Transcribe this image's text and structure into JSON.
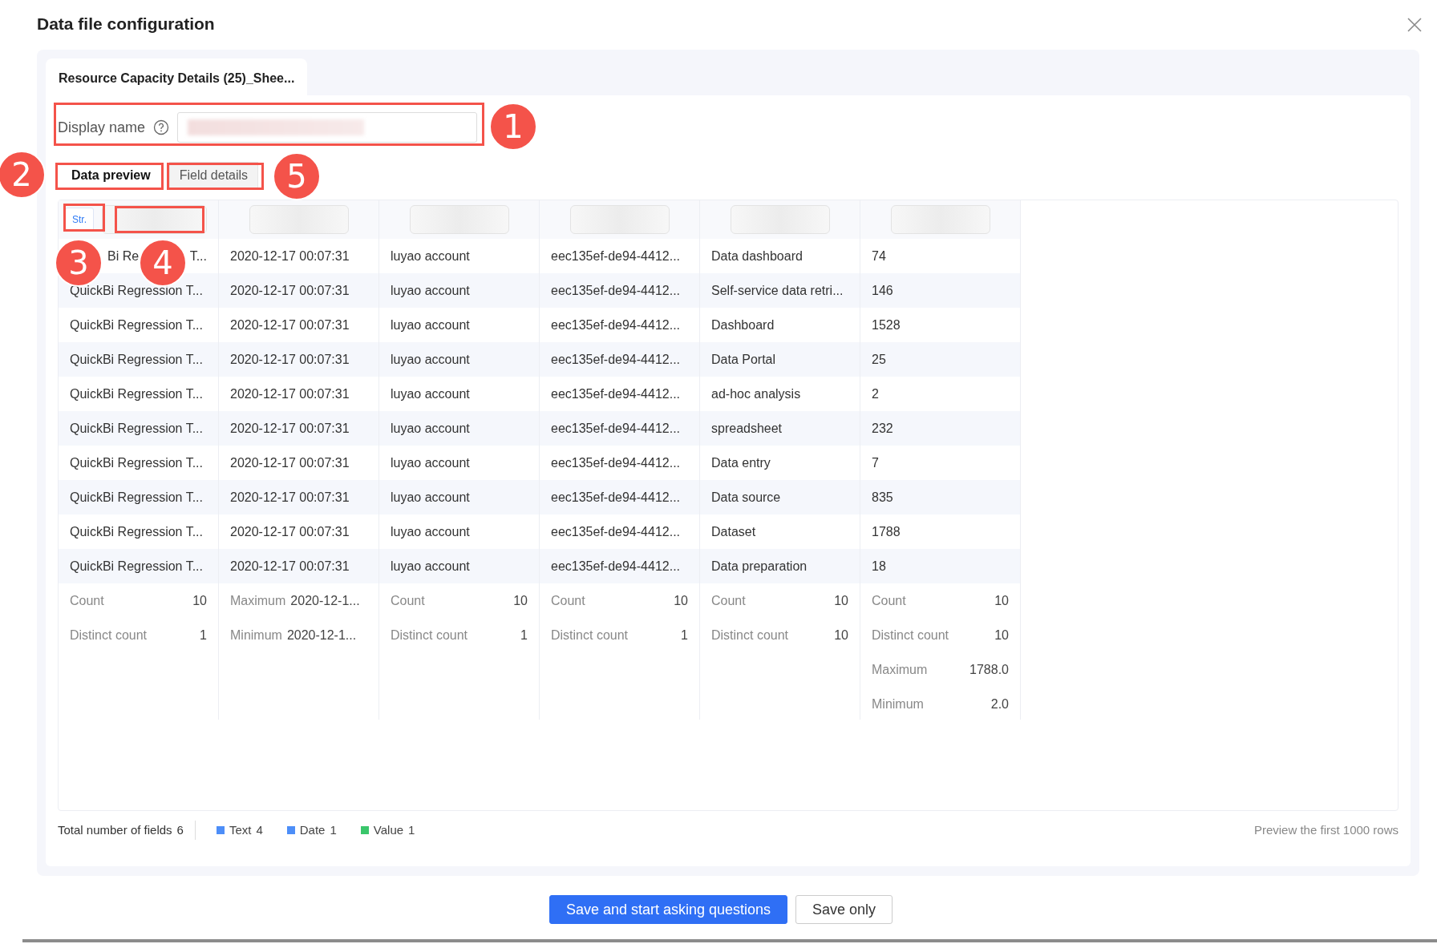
{
  "title": "Data file configuration",
  "sheet_tab": {
    "label": "Resource Capacity Details (25)_Shee...",
    "selected": true
  },
  "display_name": {
    "label": "Display name"
  },
  "view_tabs": [
    {
      "label": "Data preview",
      "selected": true
    },
    {
      "label": "Field details",
      "selected": false
    }
  ],
  "table": {
    "columns": [
      {
        "type_tag": "Str."
      },
      {},
      {},
      {},
      {},
      {}
    ],
    "rows": [
      [
        [
          "Bi Re",
          "T..."
        ],
        "2020-12-17 00:07:31",
        "luyao account",
        "eec135ef-de94-4412...",
        "Data dashboard",
        "74"
      ],
      [
        "QuickBi Regression T...",
        "2020-12-17 00:07:31",
        "luyao account",
        "eec135ef-de94-4412...",
        "Self-service data retri...",
        "146"
      ],
      [
        "QuickBi Regression T...",
        "2020-12-17 00:07:31",
        "luyao account",
        "eec135ef-de94-4412...",
        "Dashboard",
        "1528"
      ],
      [
        "QuickBi Regression T...",
        "2020-12-17 00:07:31",
        "luyao account",
        "eec135ef-de94-4412...",
        "Data Portal",
        "25"
      ],
      [
        "QuickBi Regression T...",
        "2020-12-17 00:07:31",
        "luyao account",
        "eec135ef-de94-4412...",
        "ad-hoc analysis",
        "2"
      ],
      [
        "QuickBi Regression T...",
        "2020-12-17 00:07:31",
        "luyao account",
        "eec135ef-de94-4412...",
        "spreadsheet",
        "232"
      ],
      [
        "QuickBi Regression T...",
        "2020-12-17 00:07:31",
        "luyao account",
        "eec135ef-de94-4412...",
        "Data entry",
        "7"
      ],
      [
        "QuickBi Regression T...",
        "2020-12-17 00:07:31",
        "luyao account",
        "eec135ef-de94-4412...",
        "Data source",
        "835"
      ],
      [
        "QuickBi Regression T...",
        "2020-12-17 00:07:31",
        "luyao account",
        "eec135ef-de94-4412...",
        "Dataset",
        "1788"
      ],
      [
        "QuickBi Regression T...",
        "2020-12-17 00:07:31",
        "luyao account",
        "eec135ef-de94-4412...",
        "Data preparation",
        "18"
      ]
    ],
    "stats": [
      [
        {
          "label": "Count",
          "value": "10"
        },
        {
          "label": "Distinct count",
          "value": "1"
        }
      ],
      [
        {
          "label": "Maximum",
          "value": "2020-12-1...",
          "kind": "inline"
        },
        {
          "label": "Minimum",
          "value": "2020-12-1...",
          "kind": "inline"
        }
      ],
      [
        {
          "label": "Count",
          "value": "10"
        },
        {
          "label": "Distinct count",
          "value": "1"
        }
      ],
      [
        {
          "label": "Count",
          "value": "10"
        },
        {
          "label": "Distinct count",
          "value": "1"
        }
      ],
      [
        {
          "label": "Count",
          "value": "10"
        },
        {
          "label": "Distinct count",
          "value": "10"
        }
      ],
      [
        {
          "label": "Count",
          "value": "10"
        },
        {
          "label": "Distinct count",
          "value": "10"
        },
        {
          "label": "Maximum",
          "value": "1788.0"
        },
        {
          "label": "Minimum",
          "value": "2.0"
        }
      ]
    ]
  },
  "footer": {
    "total_label": "Total number of fields",
    "total": "6",
    "legend": [
      {
        "label": "Text",
        "count": "4",
        "color": "#4d8ef8"
      },
      {
        "label": "Date",
        "count": "1",
        "color": "#4d8ef8"
      },
      {
        "label": "Value",
        "count": "1",
        "color": "#3ac66b"
      }
    ],
    "note": "Preview the first 1000 rows"
  },
  "buttons": [
    {
      "label": "Save and start asking questions",
      "kind": "primary"
    },
    {
      "label": "Save only",
      "kind": "secondary"
    }
  ],
  "callouts": [
    "1",
    "2",
    "3",
    "4",
    "5"
  ]
}
